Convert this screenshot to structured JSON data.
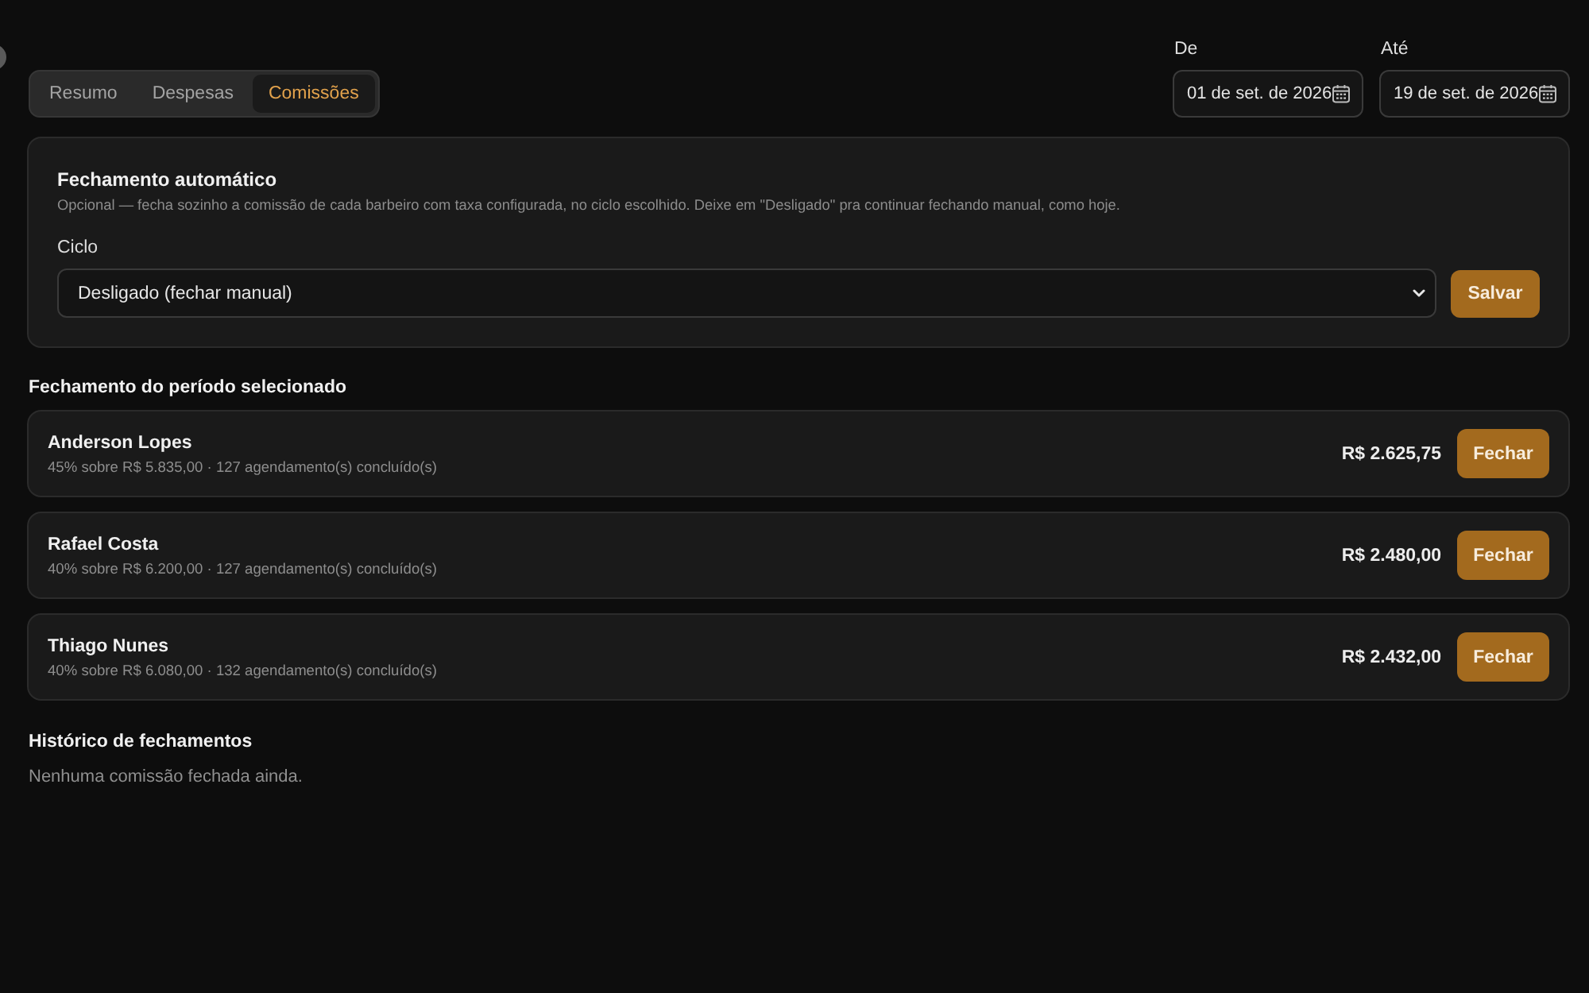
{
  "tabs": [
    {
      "label": "Resumo",
      "selected": false
    },
    {
      "label": "Despesas",
      "selected": false
    },
    {
      "label": "Comissões",
      "selected": true
    }
  ],
  "date_range": {
    "from": {
      "label": "De",
      "value": "01 de set. de 2026"
    },
    "to": {
      "label": "Até",
      "value": "19 de set. de 2026"
    }
  },
  "auto_close": {
    "title": "Fechamento automático",
    "description": "Opcional — fecha sozinho a comissão de cada barbeiro com taxa configurada, no ciclo escolhido. Deixe em \"Desligado\" pra continuar fechando manual, como hoje.",
    "cycle": {
      "label": "Ciclo",
      "value": "Desligado (fechar manual)"
    },
    "save_button": "Salvar"
  },
  "period_closing": {
    "title": "Fechamento do período selecionado",
    "barbers": [
      {
        "name": "Anderson Lopes",
        "detail": "45% sobre R$ 5.835,00 · 127 agendamento(s) concluído(s)",
        "amount": "R$ 2.625,75",
        "button": "Fechar"
      },
      {
        "name": "Rafael Costa",
        "detail": "40% sobre R$ 6.200,00 · 127 agendamento(s) concluído(s)",
        "amount": "R$ 2.480,00",
        "button": "Fechar"
      },
      {
        "name": "Thiago Nunes",
        "detail": "40% sobre R$ 6.080,00 · 132 agendamento(s) concluído(s)",
        "amount": "R$ 2.432,00",
        "button": "Fechar"
      }
    ]
  },
  "history": {
    "title": "Histórico de fechamentos",
    "empty_message": "Nenhuma comissão fechada ainda."
  }
}
